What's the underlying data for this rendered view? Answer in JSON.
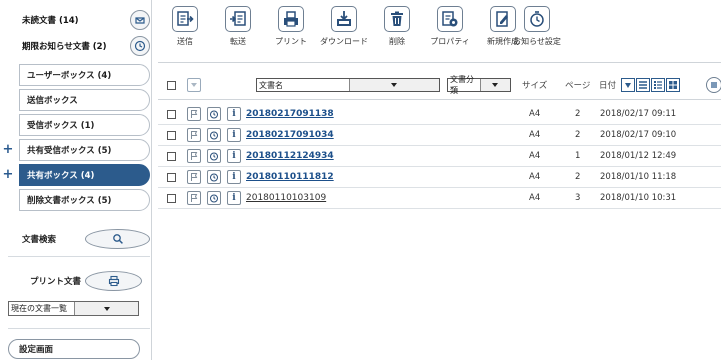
{
  "sidebar": {
    "unread_label": "未読文書 (14)",
    "expire_label": "期限お知らせ文書 (2)",
    "boxes": [
      {
        "label": "ユーザーボックス (4)",
        "plus": false,
        "active": false
      },
      {
        "label": "送信ボックス",
        "plus": false,
        "active": false
      },
      {
        "label": "受信ボックス (1)",
        "plus": false,
        "active": false
      },
      {
        "label": "共有受信ボックス (5)",
        "plus": true,
        "active": false
      },
      {
        "label": "共有ボックス (4)",
        "plus": true,
        "active": true
      },
      {
        "label": "削除文書ボックス (5)",
        "plus": false,
        "active": false
      }
    ],
    "search_label": "文書検索",
    "print_label": "プリント文書",
    "print_select_value": "現在の文書一覧",
    "settings_label": "設定画面"
  },
  "toolbar": {
    "buttons": [
      {
        "label": "送信",
        "icon": "send-icon"
      },
      {
        "label": "転送",
        "icon": "forward-icon"
      },
      {
        "label": "プリント",
        "icon": "printer-icon"
      },
      {
        "label": "ダウンロード",
        "icon": "download-icon"
      },
      {
        "label": "削除",
        "icon": "trash-icon"
      },
      {
        "label": "プロパティ",
        "icon": "properties-icon"
      },
      {
        "label": "新規作成",
        "icon": "new-document-icon"
      },
      {
        "label": "お知らせ設定",
        "icon": "timer-icon"
      }
    ]
  },
  "list_header": {
    "doc_name_value": "文書名",
    "doc_class_value": "文書分類",
    "size_label": "サイズ",
    "page_label": "ページ",
    "date_label": "日付"
  },
  "documents": [
    {
      "name": "20180217091138",
      "size": "A4",
      "pages": "2",
      "date": "2018/02/17 09:11",
      "unread": true
    },
    {
      "name": "20180217091034",
      "size": "A4",
      "pages": "2",
      "date": "2018/02/17 09:10",
      "unread": true
    },
    {
      "name": "20180112124934",
      "size": "A4",
      "pages": "1",
      "date": "2018/01/12 12:49",
      "unread": true
    },
    {
      "name": "20180110111812",
      "size": "A4",
      "pages": "2",
      "date": "2018/01/10 11:18",
      "unread": true
    },
    {
      "name": "20180110103109",
      "size": "A4",
      "pages": "3",
      "date": "2018/01/10 10:31",
      "unread": false
    }
  ],
  "colors": {
    "active_box": "#2c5b8c",
    "link": "#1c4f8a",
    "icon_border": "#6e7f92"
  }
}
